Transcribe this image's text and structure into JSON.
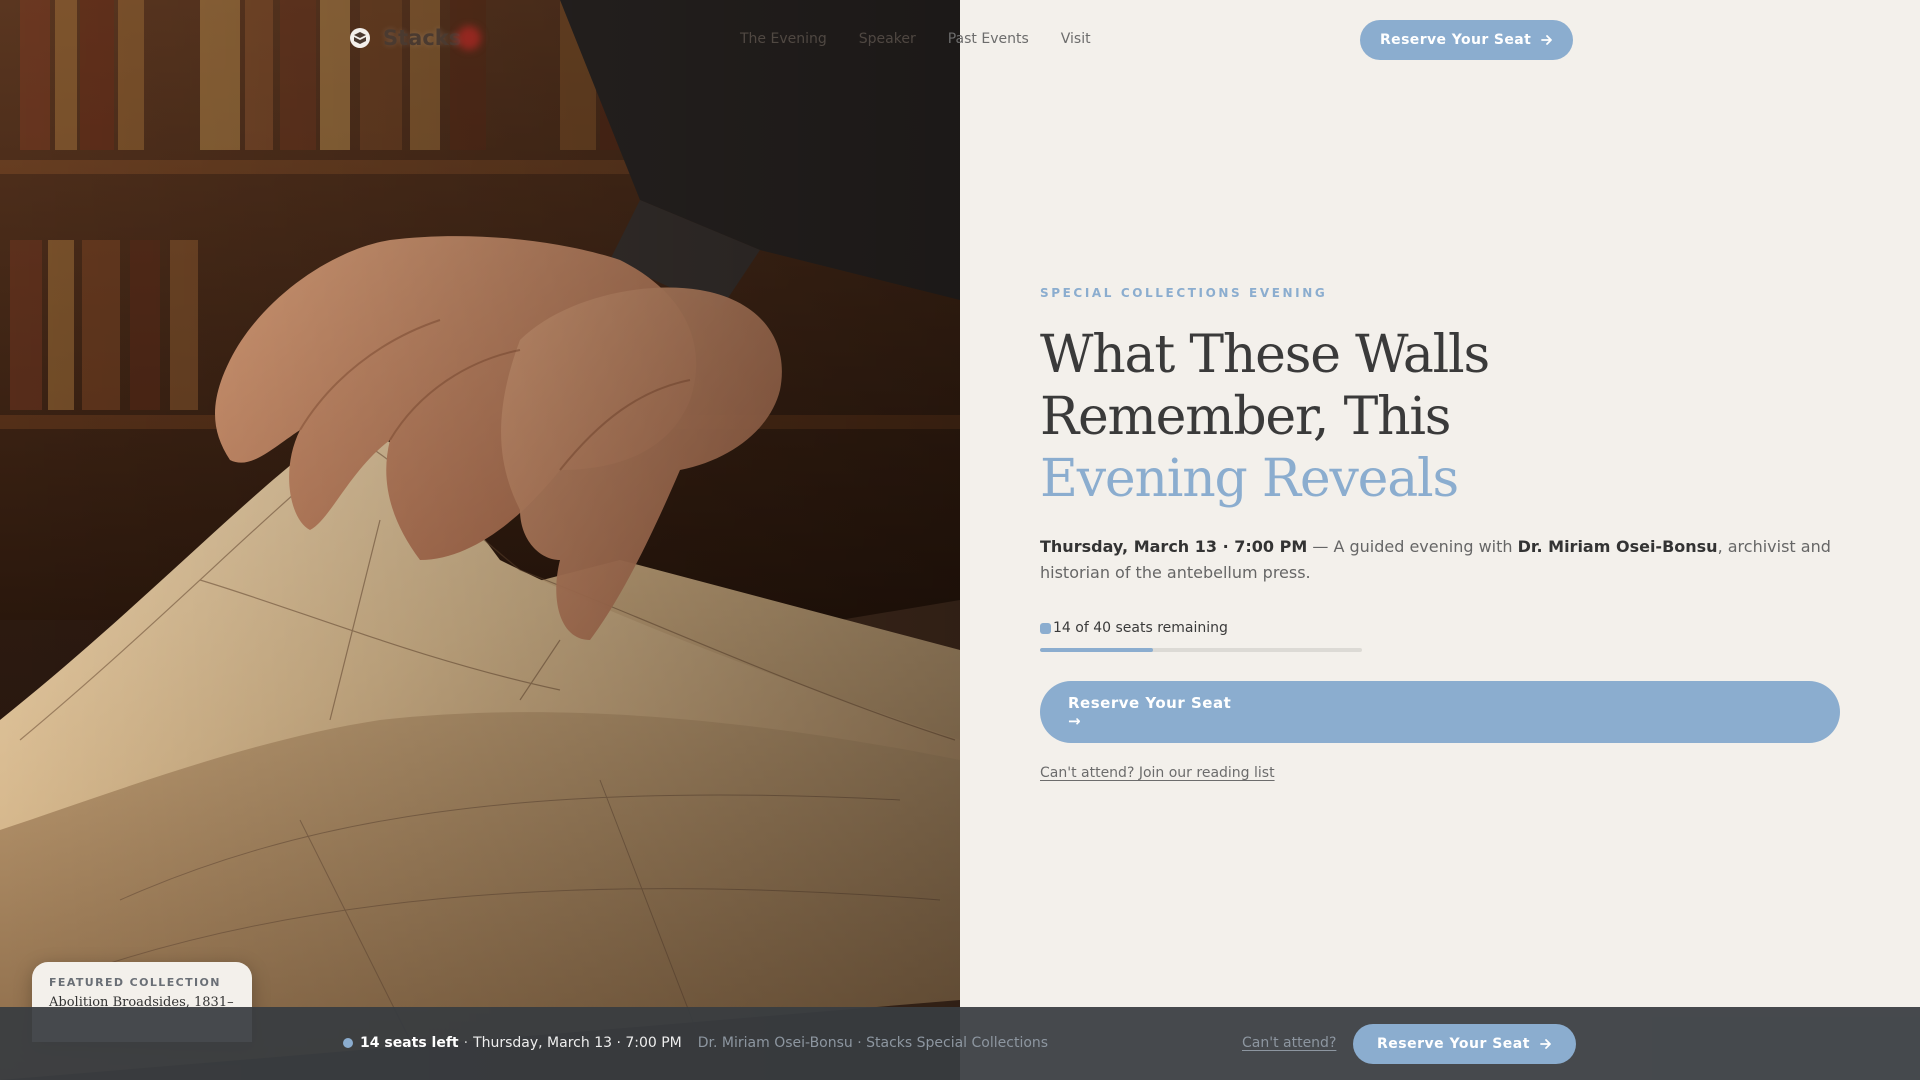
{
  "brand": {
    "name": "Stacks",
    "icon": "seal-logo-icon"
  },
  "nav": {
    "links": [
      "The Evening",
      "Speaker",
      "Past Events",
      "Visit"
    ],
    "cta_label": "Reserve Your Seat",
    "cta_icon": "arrow-right-icon"
  },
  "hero": {
    "eyebrow": "SPECIAL COLLECTIONS EVENING",
    "headline_line1": "What These Walls",
    "headline_line2": "Remember, This",
    "headline_accent": "Evening Reveals",
    "date_time": "Thursday, March 13 · 7:00 PM",
    "lede_mid": " — A guided evening with ",
    "speaker": "Dr. Miriam Osei-Bonsu",
    "lede_tail": ", archivist and historian of the antebellum press.",
    "seats_text": "14 of 40 seats remaining",
    "seats_remaining": 14,
    "seats_total": 40,
    "cta_label": "Reserve Your Seat",
    "cta_arrow": "→",
    "reading_link": "Can't attend? Join our reading list"
  },
  "featured": {
    "label": "FEATURED COLLECTION",
    "title": "Abolition Broadsides, 1831–"
  },
  "sticky_bar": {
    "seats_left": "14 seats left",
    "date_time": "Thursday, March 13 · 7:00 PM",
    "host": "Dr. Miriam Osei-Bonsu · Stacks Special Collections",
    "cant_attend": "Can't attend?",
    "cta_label": "Reserve Your Seat"
  },
  "colors": {
    "accent": "#8badcf",
    "background": "#f3f0eb",
    "text": "#3a3a3a",
    "bar": "#383c41"
  }
}
